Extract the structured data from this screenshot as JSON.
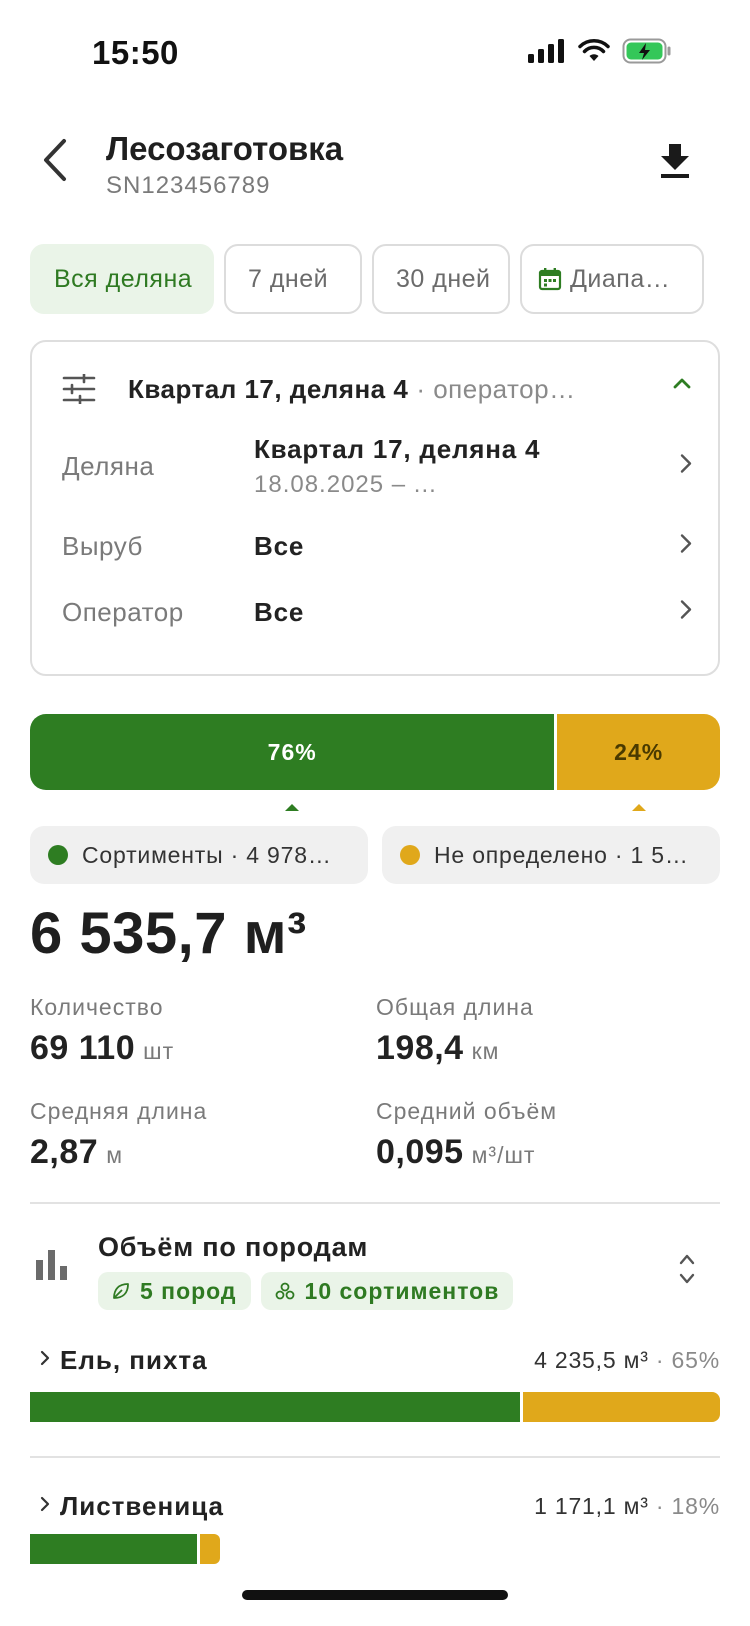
{
  "status_bar": {
    "time": "15:50"
  },
  "header": {
    "title": "Лесозаготовка",
    "serial": "SN123456789"
  },
  "tabs": [
    {
      "label": "Вся деляна",
      "active": true
    },
    {
      "label": "7 дней",
      "active": false
    },
    {
      "label": "30 дней",
      "active": false
    },
    {
      "label": "Диапа…",
      "active": false,
      "icon": "calendar-icon"
    }
  ],
  "filter": {
    "summary_bold": "Квартал 17, деляна 4",
    "summary_muted": "· оператор…",
    "rows": [
      {
        "label": "Деляна",
        "value": "Квартал 17, деляна 4",
        "sub": "18.08.2025 – ..."
      },
      {
        "label": "Выруб",
        "value": "Все"
      },
      {
        "label": "Оператор",
        "value": "Все"
      }
    ]
  },
  "split": {
    "green_pct_label": "76%",
    "yellow_pct_label": "24%",
    "green_fraction": 0.76,
    "colors": {
      "green": "#2e7d22",
      "yellow": "#e0a81b"
    }
  },
  "legend": {
    "assortments": "Сортименты · 4 978…",
    "undefined": "Не определено · 1 5…"
  },
  "total_volume": "6 535,7 м³",
  "metrics": {
    "count": {
      "label": "Количество",
      "value": "69 110",
      "unit": "шт"
    },
    "total_length": {
      "label": "Общая длина",
      "value": "198,4",
      "unit": "км"
    },
    "avg_length": {
      "label": "Средняя длина",
      "value": "2,87",
      "unit": "м"
    },
    "avg_volume": {
      "label": "Средний объём",
      "value": "0,095",
      "unit": "м³/шт"
    }
  },
  "species_section": {
    "title": "Объём по породам",
    "badge_species": "5 пород",
    "badge_assortments": "10 сортиментов",
    "items": [
      {
        "name": "Ель, пихта",
        "volume": "4 235,5 м³",
        "pct": "· 65%",
        "green_fraction": 0.71
      },
      {
        "name": "Лиственица",
        "volume": "1 171,1 м³",
        "pct": "· 18%",
        "green_fraction": 0.88
      }
    ]
  }
}
